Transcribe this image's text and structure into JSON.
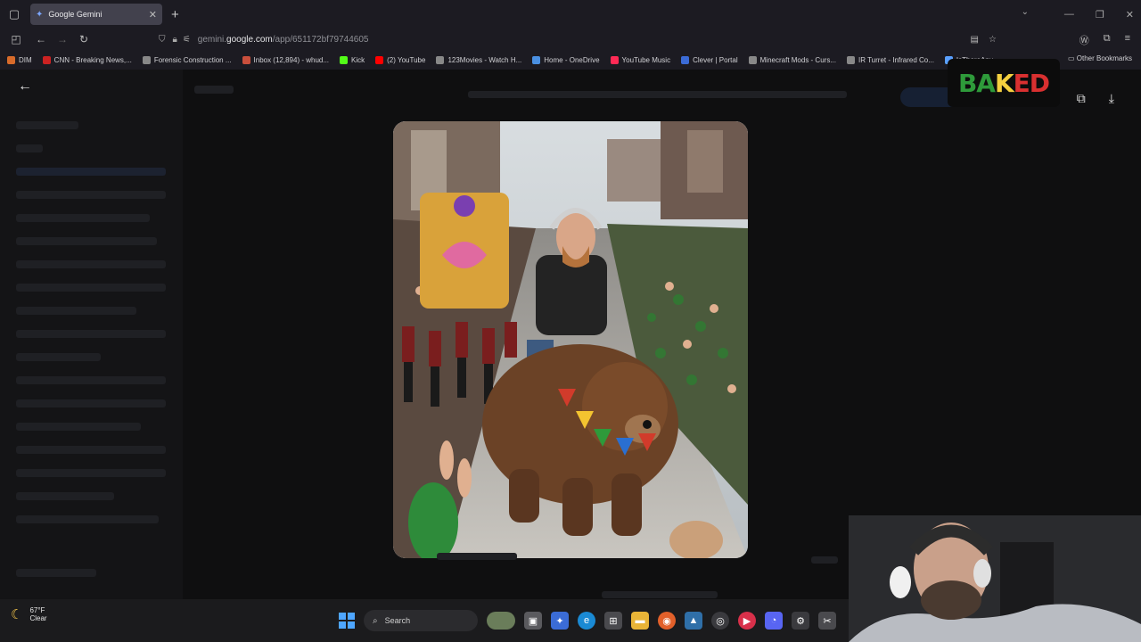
{
  "browser": {
    "tab": {
      "title": "Google Gemini"
    },
    "url": {
      "prefix": "gemini.",
      "domain": "google.com",
      "path": "/app/651172bf79744605"
    },
    "bookmarks": [
      {
        "label": "DIM",
        "color": "#d86b2a"
      },
      {
        "label": "CNN - Breaking News,...",
        "color": "#cc2222"
      },
      {
        "label": "Forensic Construction ...",
        "color": "#888888"
      },
      {
        "label": "Inbox (12,894) - whud...",
        "color": "#c94f3c"
      },
      {
        "label": "Kick",
        "color": "#53fc18"
      },
      {
        "label": "(2) YouTube",
        "color": "#ff0000"
      },
      {
        "label": "123Movies - Watch H...",
        "color": "#888888"
      },
      {
        "label": "Home - OneDrive",
        "color": "#4a90e2"
      },
      {
        "label": "YouTube Music",
        "color": "#ff2a55"
      },
      {
        "label": "Clever | Portal",
        "color": "#3b6bd6"
      },
      {
        "label": "Minecraft Mods - Curs...",
        "color": "#888888"
      },
      {
        "label": "IR Turret - Infrared Co...",
        "color": "#888888"
      },
      {
        "label": "IsThereAny",
        "color": "#5aa0ff"
      }
    ],
    "other_bookmarks": "Other Bookmarks"
  },
  "overlay": {
    "logo_text": "BAKED",
    "logo_colors": [
      "#2e9a3a",
      "#f4d03f",
      "#d93030"
    ]
  },
  "taskbar": {
    "weather": {
      "temp": "67°F",
      "condition": "Clear"
    },
    "search_label": "Search"
  },
  "colors": {
    "accent": "#4ea6ff",
    "page_bg": "#0f0f10"
  }
}
